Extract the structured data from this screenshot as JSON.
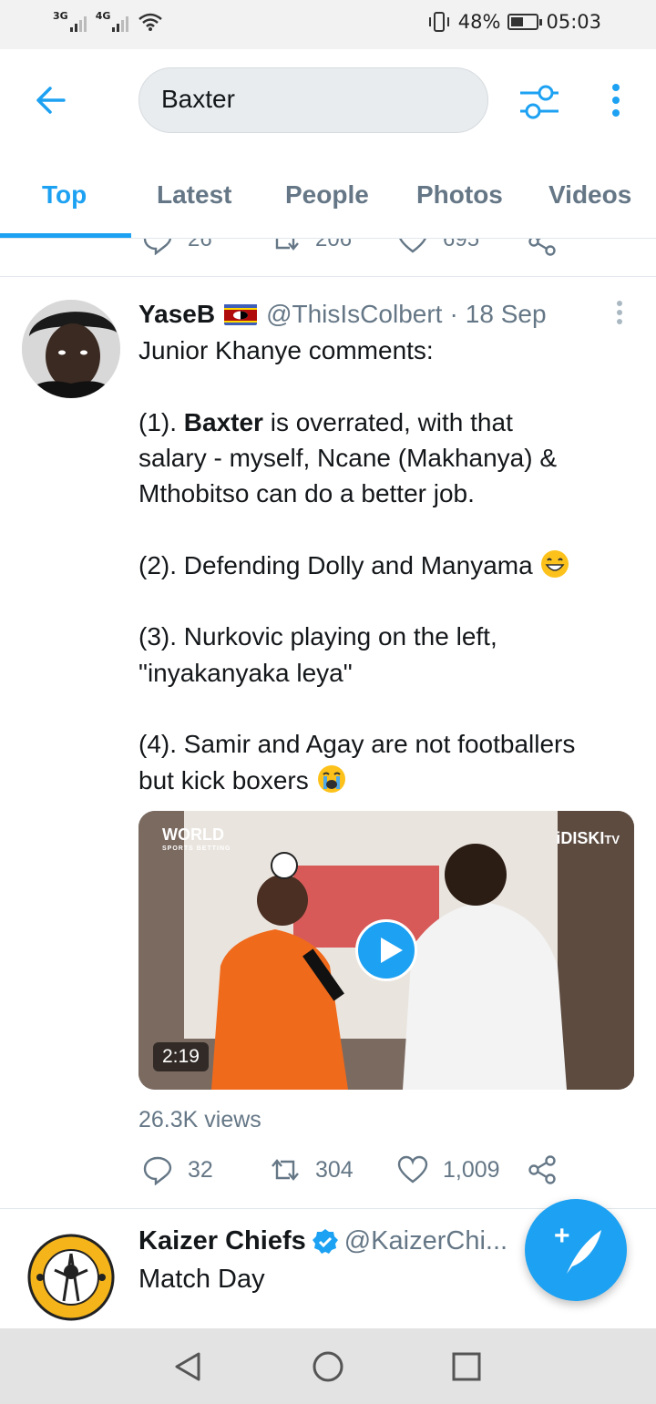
{
  "status_bar": {
    "net1": "3G",
    "net2": "4G",
    "battery_text": "48%",
    "battery_level": 0.48,
    "time": "05:03"
  },
  "search": {
    "value": "Baxter",
    "placeholder": "Search Twitter"
  },
  "tabs": [
    {
      "label": "Top",
      "active": true
    },
    {
      "label": "Latest",
      "active": false
    },
    {
      "label": "People",
      "active": false
    },
    {
      "label": "Photos",
      "active": false
    },
    {
      "label": "Videos",
      "active": false
    }
  ],
  "prev_tweet_actions": {
    "replies": "26",
    "retweets": "206",
    "likes": "695"
  },
  "tweet": {
    "name": "YaseB",
    "handle": "@ThisIsColbert",
    "dot": "·",
    "time": "18 Sep",
    "line1": "Junior Khanye comments:",
    "p1_prefix": "(1). ",
    "p1_bold": "Baxter",
    "p1_rest": " is overrated, with that",
    "p1_line2": "salary - myself, Ncane (Makhanya) &",
    "p1_line3": "Mthobitso can do a  better job.",
    "p2": "(2). Defending Dolly and Manyama ",
    "p3_line1": "(3). Nurkovic playing on the left,",
    "p3_line2": "\"inyakanyaka leya\"",
    "p4_line1": "(4). Samir and Agay are not footballers",
    "p4_line2": "but kick boxers ",
    "video_duration": "2:19",
    "video_logo_left": "WORLD",
    "video_logo_left_sub": "SPORTS BETTING",
    "video_logo_right": "iDISKI",
    "video_logo_right_suffix": "TV",
    "views": "26.3K views",
    "replies": "32",
    "retweets": "304",
    "likes": "1,009"
  },
  "next_tweet": {
    "name": "Kaizer Chiefs",
    "handle": "@KaizerChi...",
    "body": "Match Day"
  },
  "colors": {
    "accent": "#1da1f2",
    "secondary_text": "#657786"
  }
}
